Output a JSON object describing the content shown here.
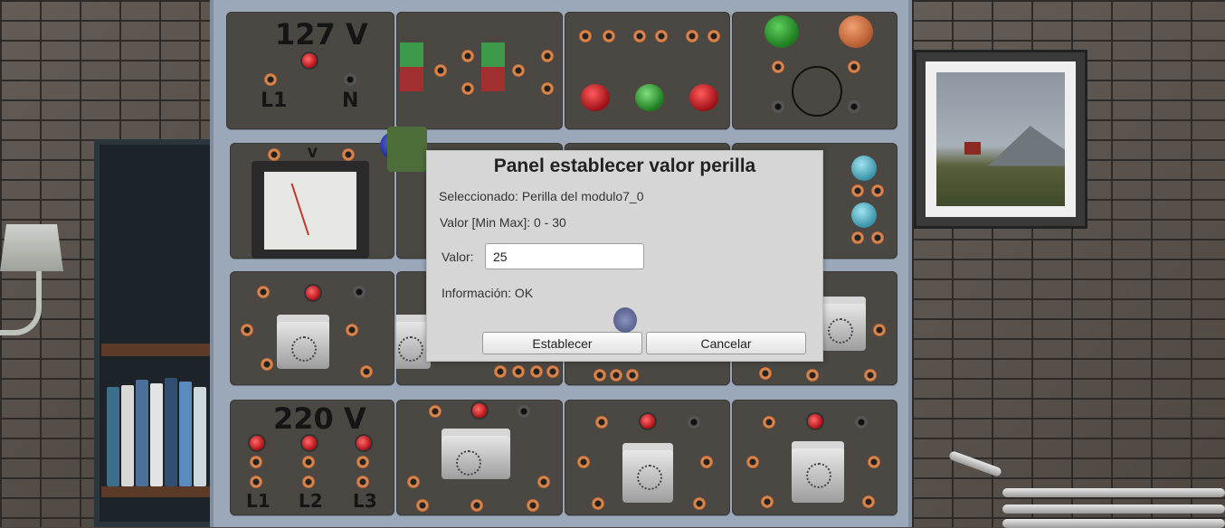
{
  "scene": {
    "modules": {
      "supply_127": {
        "voltage": "127 V",
        "labels": [
          "L1",
          "N"
        ]
      },
      "supply_220": {
        "voltage": "220 V",
        "labels": [
          "L1",
          "L2",
          "L3"
        ]
      },
      "voltmeter": {
        "unit": "V"
      }
    }
  },
  "dialog": {
    "title": "Panel establecer valor perilla",
    "selected_text": "Seleccionado: Perilla del modulo7_0",
    "range_text": "Valor [Min Max]: 0 - 30",
    "value_label": "Valor:",
    "value": "25",
    "info_text": "Información: OK",
    "set_button": "Establecer",
    "cancel_button": "Cancelar"
  },
  "colors": {
    "dialog_bg": "#d6d6d6",
    "cabinet": "#9aa8b9",
    "module": "#4b4743",
    "terminal": "#d9844a",
    "indicator_red": "#c0161d",
    "indicator_green": "#2fa82f"
  }
}
